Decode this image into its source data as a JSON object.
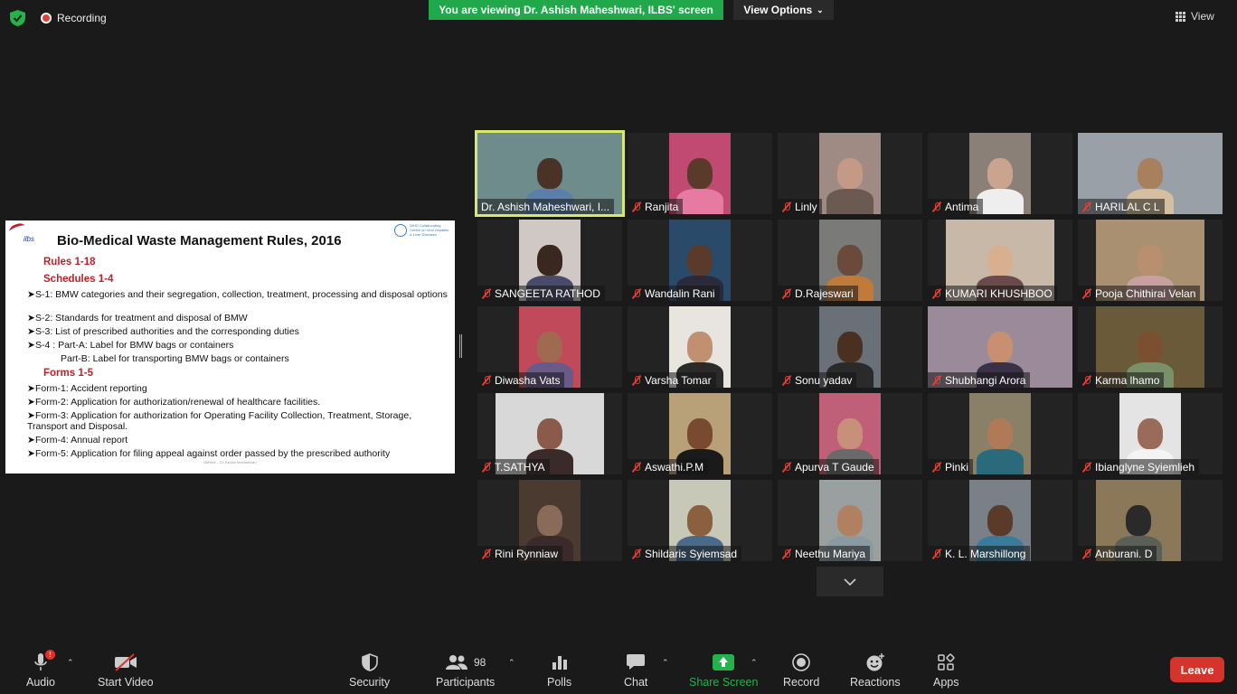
{
  "topbar": {
    "recording_label": "Recording",
    "banner_text": "You are viewing Dr. Ashish Maheshwari, ILBS' screen",
    "view_options_label": "View Options",
    "view_label": "View"
  },
  "slide": {
    "logo_text": "ilbs",
    "logo_right_text": "WHO Collaborating Centre on Viral Hepatitis & Liver Diseases",
    "title": "Bio-Medical Waste Management Rules, 2016",
    "heading_rules": "Rules 1-18",
    "heading_schedules": "Schedules 1-4",
    "schedules": [
      "S-1: BMW categories and their segregation, collection, treatment, processing and disposal options",
      "S-2: Standards for treatment and disposal of BMW",
      "S-3: List of prescribed authorities and the corresponding duties",
      "S-4 : Part-A: Label for BMW bags or containers"
    ],
    "schedule_partb": "Part-B: Label for transporting BMW bags or containers",
    "heading_forms": "Forms 1-5",
    "forms": [
      "Form-1: Accident reporting",
      "Form-2: Application for authorization/renewal of healthcare facilities.",
      "Form-3: Application for authorization for Operating Facility Collection, Treatment, Storage, Transport and Disposal.",
      "Form-4: Annual report",
      "Form-5: Application for filing appeal against order passed by the prescribed authority"
    ],
    "footer": "BMWM – Dr. Ashish Maheshwari"
  },
  "participants_tiles": [
    {
      "name": "Dr. Ashish Maheshwari, I...",
      "muted": false,
      "active": true
    },
    {
      "name": "Ranjita",
      "muted": true
    },
    {
      "name": "Linly",
      "muted": true
    },
    {
      "name": "Antima",
      "muted": true
    },
    {
      "name": "HARILAL C L",
      "muted": true
    },
    {
      "name": "SANGEETA RATHOD",
      "muted": true
    },
    {
      "name": "Wandalin Rani",
      "muted": true
    },
    {
      "name": "D.Rajeswari",
      "muted": true
    },
    {
      "name": "KUMARI KHUSHBOO",
      "muted": true
    },
    {
      "name": "Pooja Chithirai Velan",
      "muted": true
    },
    {
      "name": "Diwasha Vats",
      "muted": true
    },
    {
      "name": "Varsha Tomar",
      "muted": true
    },
    {
      "name": "Sonu yadav",
      "muted": true
    },
    {
      "name": "Shubhangi Arora",
      "muted": true
    },
    {
      "name": "Karma lhamo",
      "muted": true
    },
    {
      "name": "T.SATHYA",
      "muted": true
    },
    {
      "name": "Aswathi.P.M",
      "muted": true
    },
    {
      "name": "Apurva T Gaude",
      "muted": true
    },
    {
      "name": "Pinki",
      "muted": true
    },
    {
      "name": "Ibianglyne Syiemlieh",
      "muted": true
    },
    {
      "name": "Rini Rynniaw",
      "muted": true
    },
    {
      "name": "Shildaris Syiemsad",
      "muted": true
    },
    {
      "name": "Neethu Mariya",
      "muted": true
    },
    {
      "name": "K. L. Marshillong",
      "muted": true
    },
    {
      "name": "Anburani. D",
      "muted": true
    }
  ],
  "toolbar": {
    "audio_label": "Audio",
    "audio_badge": "!",
    "video_label": "Start Video",
    "security_label": "Security",
    "participants_label": "Participants",
    "participants_count": "98",
    "polls_label": "Polls",
    "chat_label": "Chat",
    "share_label": "Share Screen",
    "record_label": "Record",
    "reactions_label": "Reactions",
    "apps_label": "Apps",
    "leave_label": "Leave"
  },
  "colors": {
    "banner_green": "#21a84a",
    "active_speaker": "#d8e86a",
    "leave_red": "#d4342b",
    "share_green": "#23b24b",
    "slide_heading_red": "#c0202a"
  }
}
